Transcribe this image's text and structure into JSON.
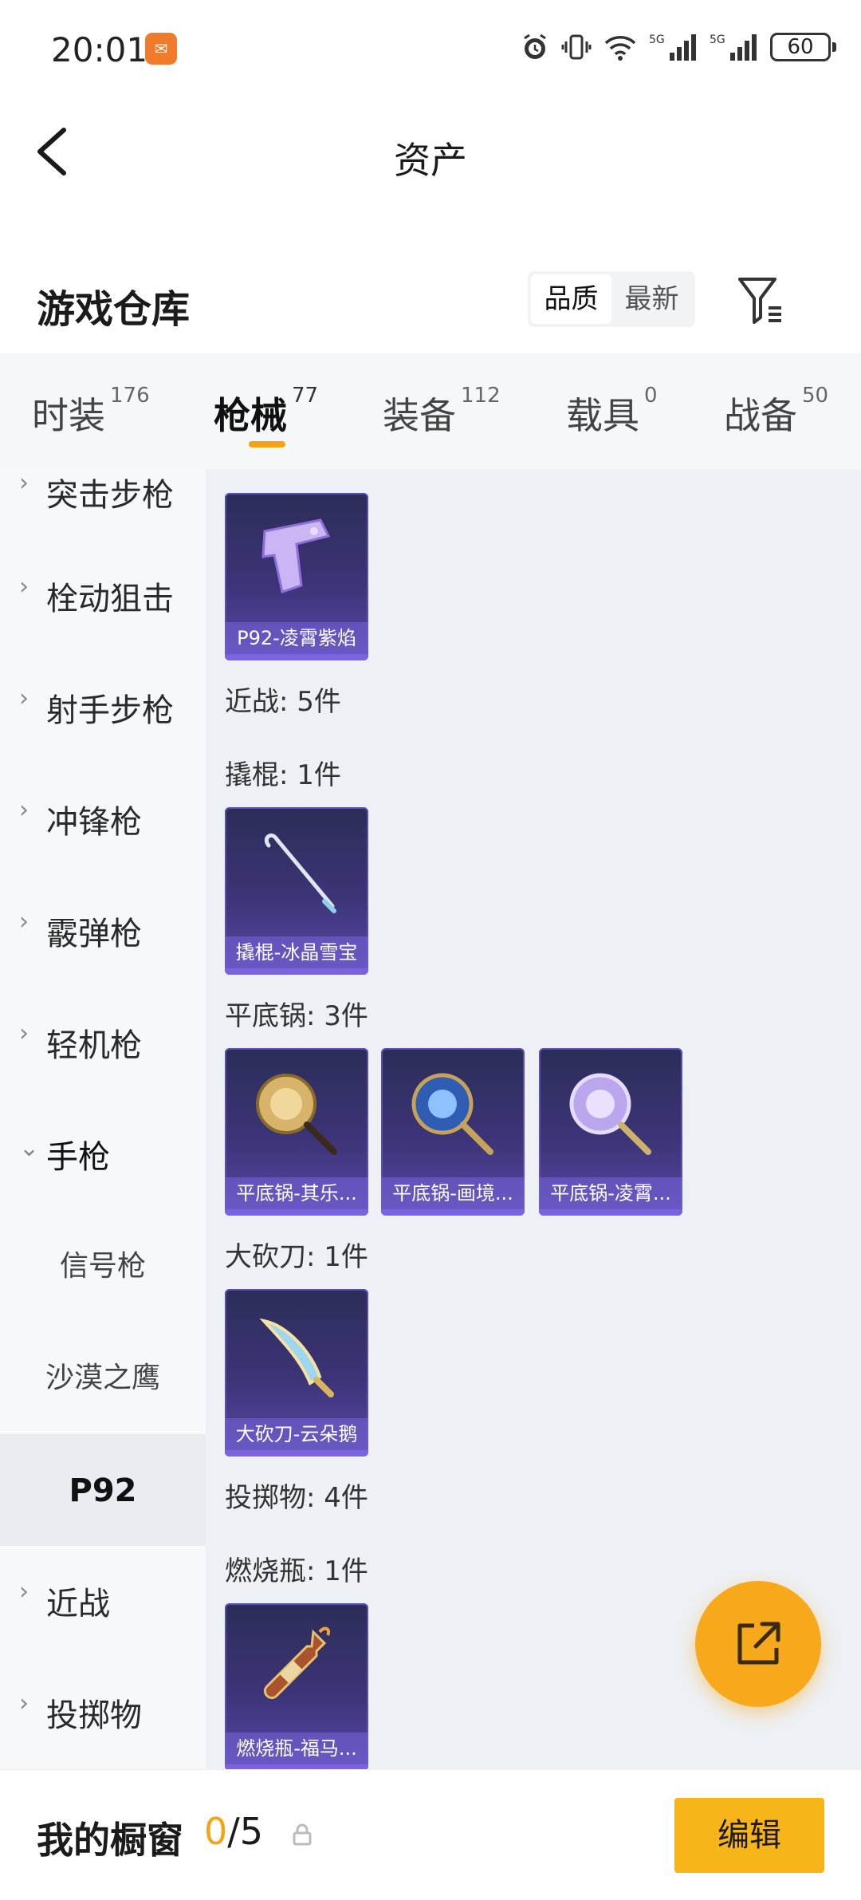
{
  "status_bar": {
    "time": "20:01",
    "battery": "60",
    "icons": [
      "alarm-icon",
      "vibrate-icon",
      "wifi-icon",
      "signal-5g-icon",
      "signal-5g-icon"
    ]
  },
  "header": {
    "title": "资产"
  },
  "warehouse": {
    "title": "游戏仓库",
    "sort_options": [
      "品质",
      "最新"
    ],
    "active_sort": "品质"
  },
  "tabs": [
    {
      "label": "时装",
      "count": "176",
      "active": false
    },
    {
      "label": "枪械",
      "count": "77",
      "active": true
    },
    {
      "label": "装备",
      "count": "112",
      "active": false
    },
    {
      "label": "载具",
      "count": "0",
      "active": false
    },
    {
      "label": "战备",
      "count": "50",
      "active": false
    }
  ],
  "sidebar": {
    "categories": [
      {
        "label": "突击步枪",
        "expanded": false
      },
      {
        "label": "栓动狙击",
        "expanded": false
      },
      {
        "label": "射手步枪",
        "expanded": false
      },
      {
        "label": "冲锋枪",
        "expanded": false
      },
      {
        "label": "霰弹枪",
        "expanded": false
      },
      {
        "label": "轻机枪",
        "expanded": false
      },
      {
        "label": "手枪",
        "expanded": true
      }
    ],
    "subitems": [
      {
        "label": "信号枪",
        "selected": false
      },
      {
        "label": "沙漠之鹰",
        "selected": false
      },
      {
        "label": "P92",
        "selected": true
      }
    ],
    "categories_after": [
      {
        "label": "近战",
        "expanded": false
      },
      {
        "label": "投掷物",
        "expanded": false
      }
    ]
  },
  "content": {
    "labels": {
      "melee": "近战: 5件",
      "crowbar": "撬棍: 1件",
      "pan": "平底锅: 3件",
      "machete": "大砍刀: 1件",
      "throwables": "投掷物: 4件",
      "molotov": "燃烧瓶: 1件"
    },
    "cards": {
      "p92": "P92-凌霄紫焰",
      "crowbar": "撬棍-冰晶雪宝",
      "pan1": "平底锅-其乐...",
      "pan2": "平底锅-画境...",
      "pan3": "平底锅-凌霄...",
      "machete": "大砍刀-云朵鹅",
      "molotov": "燃烧瓶-福马..."
    }
  },
  "bottom": {
    "showcase_label": "我的橱窗",
    "count_current": "0",
    "count_total": "/5",
    "edit_label": "编辑"
  },
  "colors": {
    "accent": "#f3a416",
    "card_bg": "#3d3478",
    "content_bg": "#edf0f4"
  }
}
